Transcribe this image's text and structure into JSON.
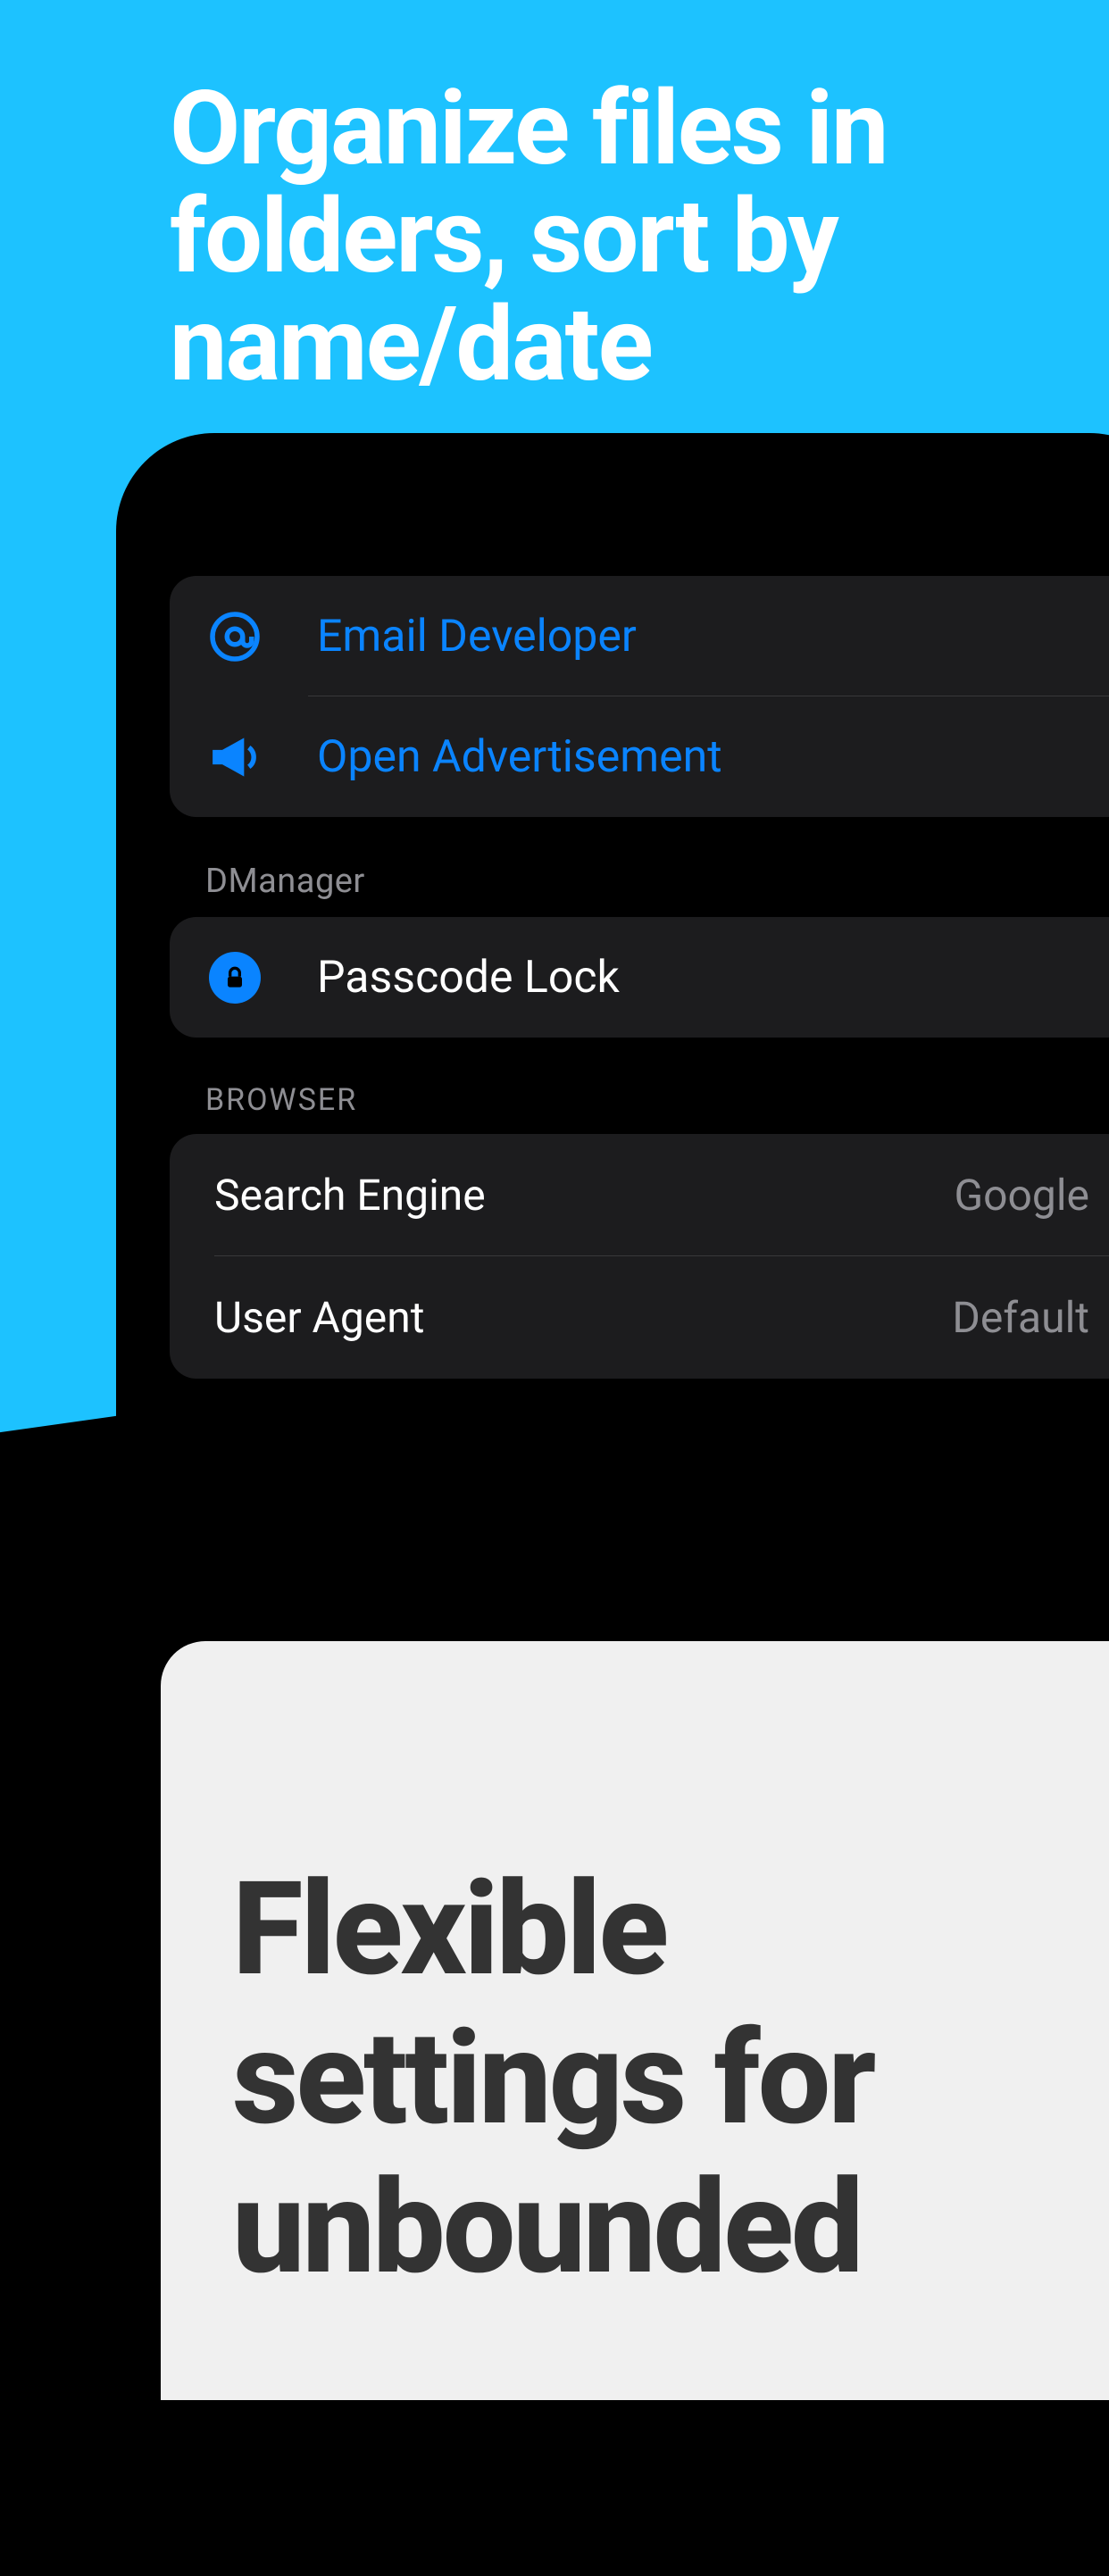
{
  "headline": "Organize files in folders, sort by name/date",
  "group1": {
    "items": [
      {
        "icon": "at-icon",
        "label": "Email Developer"
      },
      {
        "icon": "megaphone-icon",
        "label": "Open Advertisement"
      }
    ]
  },
  "section1": {
    "label": "DManager",
    "items": [
      {
        "icon": "lock-icon",
        "label": "Passcode Lock"
      }
    ]
  },
  "section2": {
    "label": "BROWSER",
    "items": [
      {
        "label": "Search Engine",
        "value": "Google"
      },
      {
        "label": "User Agent",
        "value": "Default"
      }
    ]
  },
  "bottomCard": "Flexible settings for unbounded"
}
